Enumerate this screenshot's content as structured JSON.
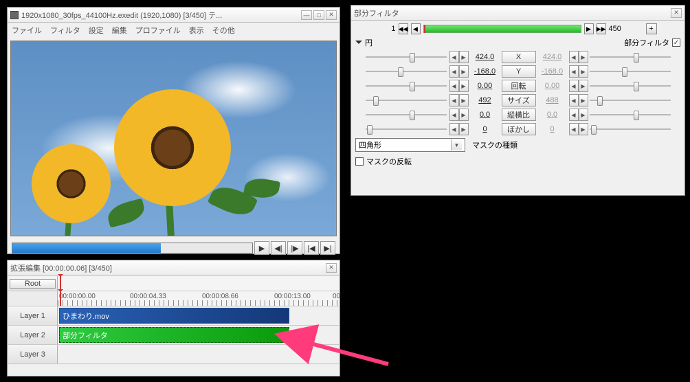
{
  "main": {
    "title": "1920x1080_30fps_44100Hz.exedit (1920,1080) [3/450] テ...",
    "menu": [
      "ファイル",
      "フィルタ",
      "設定",
      "編集",
      "プロファイル",
      "表示",
      "その他"
    ],
    "transport_icons": {
      "play": "▶",
      "step_back": "◀|",
      "step_fwd": "|▶",
      "prev": "|◀",
      "next": "▶|"
    }
  },
  "timeline": {
    "title": "拡張編集 [00:00:00.06] [3/450]",
    "root": "Root",
    "times": [
      "00:00:00.00",
      "00:00:04.33",
      "00:00:08.66",
      "00:00:13.00",
      "00"
    ],
    "layers": [
      "Layer 1",
      "Layer 2",
      "Layer 3"
    ],
    "clip1": "ひまわり.mov",
    "clip2": "部分フィルタ"
  },
  "filter": {
    "title": "部分フィルタ",
    "frame_start": "1",
    "frame_end": "450",
    "header_label": "円",
    "header_filter": "部分フィルタ",
    "params": [
      {
        "name": "X",
        "l": "424.0",
        "r": "424.0",
        "lp": 55,
        "rp": 55
      },
      {
        "name": "Y",
        "l": "-168.0",
        "r": "-168.0",
        "lp": 40,
        "rp": 40
      },
      {
        "name": "回転",
        "l": "0.00",
        "r": "0.00",
        "lp": 55,
        "rp": 55
      },
      {
        "name": "サイズ",
        "l": "492",
        "r": "488",
        "lp": 10,
        "rp": 10
      },
      {
        "name": "縦横比",
        "l": "0.0",
        "r": "0.0",
        "lp": 55,
        "rp": 55
      },
      {
        "name": "ぼかし",
        "l": "0",
        "r": "0",
        "lp": 2,
        "rp": 2
      }
    ],
    "mask_type_label": "マスクの種類",
    "mask_type_value": "四角形",
    "mask_invert": "マスクの反転"
  }
}
